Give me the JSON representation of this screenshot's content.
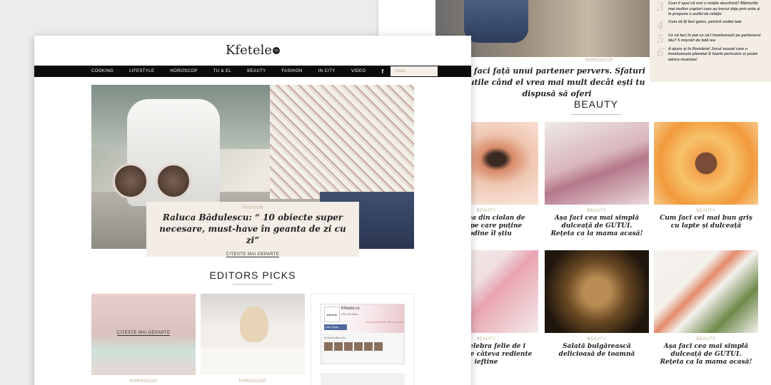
{
  "colors": {
    "accent": "#bba98f",
    "nav_bg": "#0b0b0b",
    "caption_bg": "#f3ede6"
  },
  "back_page": {
    "hero_tag": "HOROSCOP",
    "hero_title": "i faci față unui partener pervers. Sfaturi utile când el vrea mai mult decât ești tu dispusă să oferi",
    "side_list": [
      {
        "num": "3",
        "text": "Cum îi spui că vrei o relație deschisă? Mărturiile mai multor cupluri care au trecut deja prin asta și le propune o astfel de relație"
      },
      {
        "num": "4",
        "text": "Cum să îți faci gelos, petrivit zodiei tale"
      },
      {
        "num": "5",
        "text": "Ce să faci în pat ca să-l înnebunești pe partenerul tău? 5 mișcări de fată rea"
      },
      {
        "num": "6",
        "text": "A ajuns și în România! Jocul sexual care o înnebunește planeta! E foarte periculos și poate aduce moartea!"
      }
    ],
    "section_title": "BEAUTY",
    "cards": [
      {
        "tag": "BEAUTY",
        "title": "e ciorba din ciolan de rețul pe care puține spodine îl știu"
      },
      {
        "tag": "BEAUTY",
        "title": "Așa faci cea mai simplă dulceață de GUTUI. Rețeta ca la mama acasă!"
      },
      {
        "tag": "BEAUTY",
        "title": "Cum faci cel mai bun griș cu lapte și dulceață"
      },
      {
        "tag": "BEAUTY",
        "title": "pară celebra felie de i nevoie de câteva rediente ieftine"
      },
      {
        "tag": "BEAUTY",
        "title": "Salată bulgărească delicioasă de toamnă"
      },
      {
        "tag": "BEAUTY",
        "title": "Așa faci cea mai simplă dulceață de GUTUI. Rețeta ca la mama acasă!"
      }
    ]
  },
  "front_page": {
    "logo": "Kfetele",
    "logo_badge": "ro",
    "nav": [
      "COOKING",
      "LIFESTYLE",
      "HOROSCOP",
      "TU & EL",
      "BEAUTY",
      "FASHION",
      "IN CITY",
      "VIDEO"
    ],
    "fb_icon": "f",
    "search_placeholder": "Caută...",
    "feature": {
      "tag": "FASHION",
      "title": "Raluca Bădulescu: “ 10 obiecte super necesare, must-have în geanta de zi cu zi”",
      "more": "CITESTE MAI DEPARTE"
    },
    "picks_title": "EDITORS PICKS",
    "picks": [
      {
        "more": "CITESTE MAI DEPARTE",
        "tag": "HOROSCOP"
      },
      {
        "tag": "HOROSCOP"
      }
    ],
    "fb_widget": {
      "avatar_text": "Kfetele",
      "name": "Kfetele.ro",
      "likes": "332,150 likes",
      "tagline": "Toate prietenele tale sunt aici",
      "like_button": "Like Page",
      "friends": "8 friends like this"
    }
  }
}
